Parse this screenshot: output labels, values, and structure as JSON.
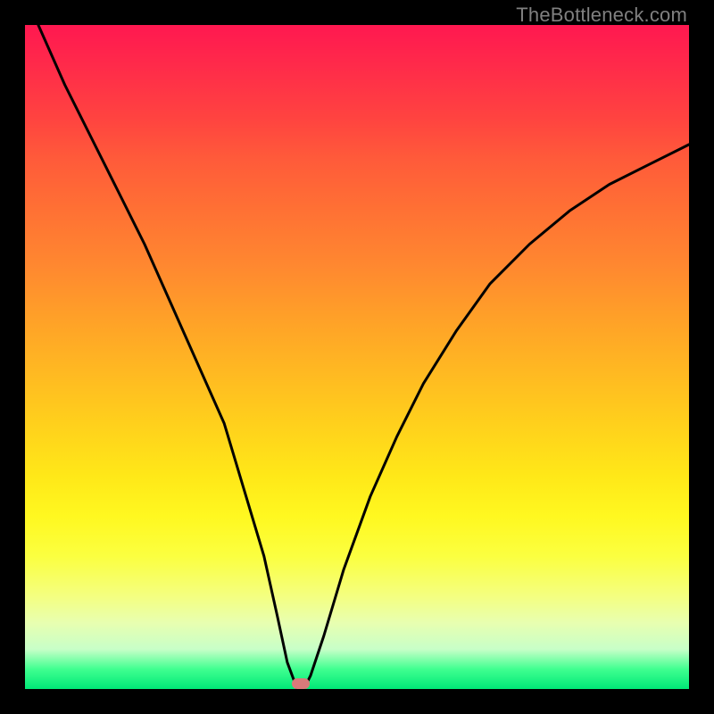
{
  "watermark": "TheBottleneck.com",
  "chart_data": {
    "type": "line",
    "title": "",
    "xlabel": "",
    "ylabel": "",
    "xlim": [
      0,
      100
    ],
    "ylim": [
      0,
      100
    ],
    "background": "rainbow-gradient",
    "series": [
      {
        "name": "bottleneck-curve",
        "x": [
          2,
          6,
          10,
          14,
          18,
          22,
          26,
          30,
          33,
          36,
          38,
          39.5,
          41,
          42,
          43,
          45,
          48,
          52,
          56,
          60,
          65,
          70,
          76,
          82,
          88,
          94,
          100
        ],
        "values": [
          100,
          91,
          83,
          75,
          67,
          58,
          49,
          40,
          30,
          20,
          11,
          4,
          0,
          0,
          2,
          8,
          18,
          29,
          38,
          46,
          54,
          61,
          67,
          72,
          76,
          79,
          82
        ]
      }
    ],
    "annotations": [
      {
        "name": "optimal-marker",
        "x": 41.5,
        "y": 0.8,
        "shape": "rounded-pill",
        "color": "#d97a7a"
      }
    ]
  },
  "colors": {
    "frame": "#000000",
    "curve": "#000000",
    "marker": "#d97a7a",
    "watermark": "#808080"
  }
}
